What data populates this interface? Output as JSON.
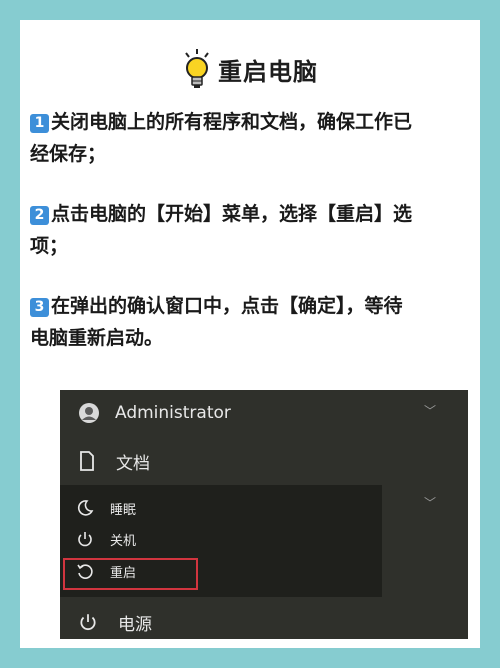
{
  "header": {
    "title": "重启电脑",
    "icon": "lightbulb-icon"
  },
  "steps": [
    {
      "num": "1",
      "line1": "关闭电脑上的所有程序和文档，确保工作已",
      "line2": "经保存；"
    },
    {
      "num": "2",
      "line1": "点击电脑的【开始】菜单，选择【重启】选",
      "line2": "项；"
    },
    {
      "num": "3",
      "line1": "在弹出的确认窗口中，点击【确定】，等待",
      "line2": "电脑重新启动。"
    }
  ],
  "start_menu": {
    "user": "Administrator",
    "documents": "文档",
    "power": "电源",
    "power_options": {
      "sleep": "睡眠",
      "shutdown": "关机",
      "restart": "重启"
    }
  },
  "colors": {
    "background": "#86ccd0",
    "highlight": "#d2353f",
    "menu_bg": "#2f302b"
  }
}
